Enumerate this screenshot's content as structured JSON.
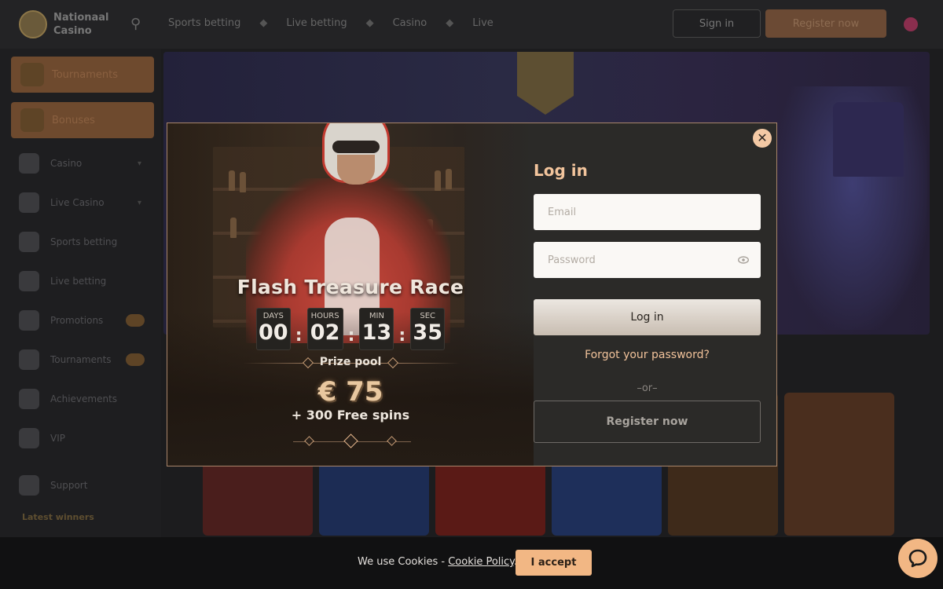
{
  "topbar": {
    "logo_line1": "Nationaal",
    "logo_line2": "Casino",
    "nav": [
      "Sports betting",
      "Live betting",
      "Casino",
      "Live"
    ],
    "signin_label": "Sign in",
    "register_label": "Register now"
  },
  "sidebar": {
    "promos": [
      {
        "label": "Tournaments",
        "icon": "trophy-icon"
      },
      {
        "label": "Bonuses",
        "icon": "gift-icon"
      }
    ],
    "items": [
      {
        "label": "Casino",
        "icon": "slots-icon"
      },
      {
        "label": "Live Casino",
        "icon": "dealer-icon"
      },
      {
        "label": "Sports betting",
        "icon": "ball-icon"
      },
      {
        "label": "Live betting",
        "icon": "live-icon"
      },
      {
        "label": "Promotions",
        "icon": "megaphone-icon"
      },
      {
        "label": "Tournaments",
        "icon": "cup-icon"
      },
      {
        "label": "Achievements",
        "icon": "laurel-icon"
      },
      {
        "label": "VIP",
        "icon": "diamond-icon"
      },
      {
        "label": "Support",
        "icon": "headset-icon"
      }
    ],
    "section_title": "Latest winners"
  },
  "modal": {
    "promo": {
      "title": "Flash Treasure Race",
      "countdown": [
        {
          "label": "DAYS",
          "value": "00"
        },
        {
          "label": "HOURS",
          "value": "02"
        },
        {
          "label": "MIN",
          "value": "13"
        },
        {
          "label": "SEC",
          "value": "35"
        }
      ],
      "colon": ":",
      "prize_label": "Prize pool",
      "prize_amount": "€ 75",
      "prize_spins": "+ 300 Free spins"
    },
    "login": {
      "title": "Log in",
      "email_placeholder": "Email",
      "password_placeholder": "Password",
      "login_button": "Log in",
      "forgot_password": "Forgot your password?",
      "or_text": "–or–",
      "register_button": "Register now"
    },
    "close_icon": "close-icon"
  },
  "cookie": {
    "text": "We use Cookies - ",
    "link": "Cookie Policy",
    "period": ".",
    "accept": "I accept"
  },
  "colors": {
    "accent": "#f2c49c",
    "button_accent": "#f2b784",
    "modal_border": "#a9856a",
    "modal_bg": "#2b2a28"
  }
}
